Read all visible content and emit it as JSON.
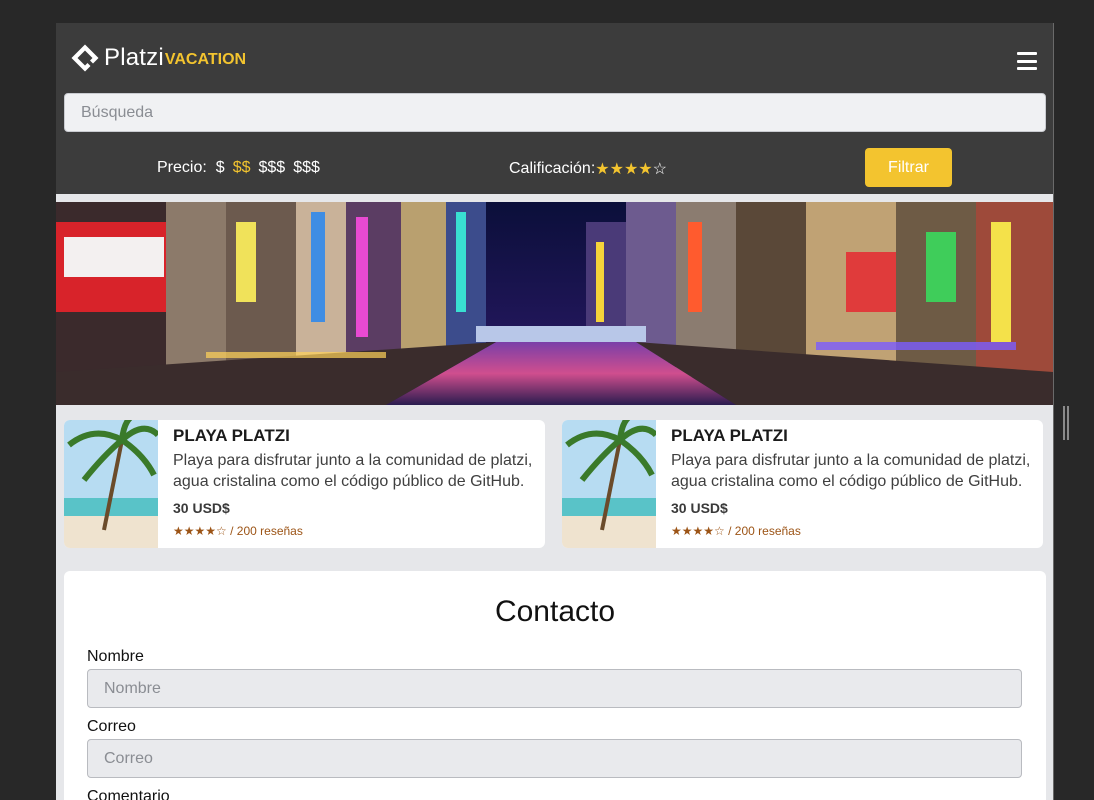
{
  "brand": {
    "name": "Platzi",
    "suffix": "VACATION"
  },
  "search": {
    "placeholder": "Búsqueda"
  },
  "filters": {
    "price_label": "Precio:",
    "price_options": [
      "$",
      "$$",
      "$$$",
      "$$$"
    ],
    "price_selected_index": 1,
    "rating_label": "Calificación:",
    "rating_stars": "★★★★",
    "rating_empty": "☆",
    "rating_value": 4,
    "rating_max": 5,
    "button_label": "Filtrar"
  },
  "cards": [
    {
      "title": "PLAYA PLATZI",
      "description": "Playa para disfrutar junto a la comunidad de platzi, agua cristalina como el código público de GitHub.",
      "price": "30 USD$",
      "stars": "★★★★☆",
      "reviews": "/ 200 reseñas"
    },
    {
      "title": "PLAYA PLATZI",
      "description": "Playa para disfrutar junto a la comunidad de platzi, agua cristalina como el código público de GitHub.",
      "price": "30 USD$",
      "stars": "★★★★☆",
      "reviews": "/ 200 reseñas"
    }
  ],
  "contact": {
    "title": "Contacto",
    "name_label": "Nombre",
    "name_placeholder": "Nombre",
    "email_label": "Correo",
    "email_placeholder": "Correo",
    "comment_label": "Comentario"
  },
  "colors": {
    "header_bg": "#3c3c3c",
    "accent": "#f3c42f",
    "page_bg": "#e6e7ea",
    "rating_text": "#9c5416"
  }
}
